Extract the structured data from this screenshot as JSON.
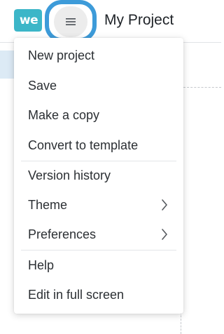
{
  "header": {
    "logo_text": "we",
    "project_title": "My Project",
    "menu_icon": "hamburger-icon"
  },
  "colors": {
    "logo": "#3cb6c8",
    "highlight_ring": "#3d9bd9",
    "menu_button_bg": "#ececec"
  },
  "menu": {
    "items": [
      {
        "label": "New project",
        "icon": ""
      },
      {
        "label": "Save",
        "icon": ""
      },
      {
        "label": "Make a copy",
        "icon": ""
      },
      {
        "label": "Convert to template",
        "icon": ""
      },
      {
        "label": "Version history",
        "icon": ""
      },
      {
        "label": "Theme",
        "icon": "chevron-right-icon"
      },
      {
        "label": "Preferences",
        "icon": "chevron-right-icon"
      },
      {
        "label": "Help",
        "icon": ""
      },
      {
        "label": "Edit in full screen",
        "icon": ""
      }
    ]
  }
}
